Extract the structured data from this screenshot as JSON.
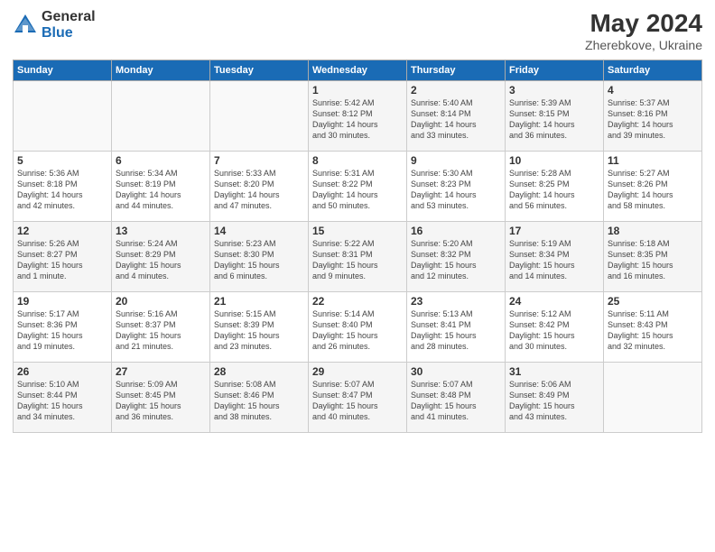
{
  "header": {
    "logo_general": "General",
    "logo_blue": "Blue",
    "month_year": "May 2024",
    "location": "Zherebkove, Ukraine"
  },
  "weekdays": [
    "Sunday",
    "Monday",
    "Tuesday",
    "Wednesday",
    "Thursday",
    "Friday",
    "Saturday"
  ],
  "weeks": [
    [
      {
        "day": "",
        "info": ""
      },
      {
        "day": "",
        "info": ""
      },
      {
        "day": "",
        "info": ""
      },
      {
        "day": "1",
        "info": "Sunrise: 5:42 AM\nSunset: 8:12 PM\nDaylight: 14 hours\nand 30 minutes."
      },
      {
        "day": "2",
        "info": "Sunrise: 5:40 AM\nSunset: 8:14 PM\nDaylight: 14 hours\nand 33 minutes."
      },
      {
        "day": "3",
        "info": "Sunrise: 5:39 AM\nSunset: 8:15 PM\nDaylight: 14 hours\nand 36 minutes."
      },
      {
        "day": "4",
        "info": "Sunrise: 5:37 AM\nSunset: 8:16 PM\nDaylight: 14 hours\nand 39 minutes."
      }
    ],
    [
      {
        "day": "5",
        "info": "Sunrise: 5:36 AM\nSunset: 8:18 PM\nDaylight: 14 hours\nand 42 minutes."
      },
      {
        "day": "6",
        "info": "Sunrise: 5:34 AM\nSunset: 8:19 PM\nDaylight: 14 hours\nand 44 minutes."
      },
      {
        "day": "7",
        "info": "Sunrise: 5:33 AM\nSunset: 8:20 PM\nDaylight: 14 hours\nand 47 minutes."
      },
      {
        "day": "8",
        "info": "Sunrise: 5:31 AM\nSunset: 8:22 PM\nDaylight: 14 hours\nand 50 minutes."
      },
      {
        "day": "9",
        "info": "Sunrise: 5:30 AM\nSunset: 8:23 PM\nDaylight: 14 hours\nand 53 minutes."
      },
      {
        "day": "10",
        "info": "Sunrise: 5:28 AM\nSunset: 8:25 PM\nDaylight: 14 hours\nand 56 minutes."
      },
      {
        "day": "11",
        "info": "Sunrise: 5:27 AM\nSunset: 8:26 PM\nDaylight: 14 hours\nand 58 minutes."
      }
    ],
    [
      {
        "day": "12",
        "info": "Sunrise: 5:26 AM\nSunset: 8:27 PM\nDaylight: 15 hours\nand 1 minute."
      },
      {
        "day": "13",
        "info": "Sunrise: 5:24 AM\nSunset: 8:29 PM\nDaylight: 15 hours\nand 4 minutes."
      },
      {
        "day": "14",
        "info": "Sunrise: 5:23 AM\nSunset: 8:30 PM\nDaylight: 15 hours\nand 6 minutes."
      },
      {
        "day": "15",
        "info": "Sunrise: 5:22 AM\nSunset: 8:31 PM\nDaylight: 15 hours\nand 9 minutes."
      },
      {
        "day": "16",
        "info": "Sunrise: 5:20 AM\nSunset: 8:32 PM\nDaylight: 15 hours\nand 12 minutes."
      },
      {
        "day": "17",
        "info": "Sunrise: 5:19 AM\nSunset: 8:34 PM\nDaylight: 15 hours\nand 14 minutes."
      },
      {
        "day": "18",
        "info": "Sunrise: 5:18 AM\nSunset: 8:35 PM\nDaylight: 15 hours\nand 16 minutes."
      }
    ],
    [
      {
        "day": "19",
        "info": "Sunrise: 5:17 AM\nSunset: 8:36 PM\nDaylight: 15 hours\nand 19 minutes."
      },
      {
        "day": "20",
        "info": "Sunrise: 5:16 AM\nSunset: 8:37 PM\nDaylight: 15 hours\nand 21 minutes."
      },
      {
        "day": "21",
        "info": "Sunrise: 5:15 AM\nSunset: 8:39 PM\nDaylight: 15 hours\nand 23 minutes."
      },
      {
        "day": "22",
        "info": "Sunrise: 5:14 AM\nSunset: 8:40 PM\nDaylight: 15 hours\nand 26 minutes."
      },
      {
        "day": "23",
        "info": "Sunrise: 5:13 AM\nSunset: 8:41 PM\nDaylight: 15 hours\nand 28 minutes."
      },
      {
        "day": "24",
        "info": "Sunrise: 5:12 AM\nSunset: 8:42 PM\nDaylight: 15 hours\nand 30 minutes."
      },
      {
        "day": "25",
        "info": "Sunrise: 5:11 AM\nSunset: 8:43 PM\nDaylight: 15 hours\nand 32 minutes."
      }
    ],
    [
      {
        "day": "26",
        "info": "Sunrise: 5:10 AM\nSunset: 8:44 PM\nDaylight: 15 hours\nand 34 minutes."
      },
      {
        "day": "27",
        "info": "Sunrise: 5:09 AM\nSunset: 8:45 PM\nDaylight: 15 hours\nand 36 minutes."
      },
      {
        "day": "28",
        "info": "Sunrise: 5:08 AM\nSunset: 8:46 PM\nDaylight: 15 hours\nand 38 minutes."
      },
      {
        "day": "29",
        "info": "Sunrise: 5:07 AM\nSunset: 8:47 PM\nDaylight: 15 hours\nand 40 minutes."
      },
      {
        "day": "30",
        "info": "Sunrise: 5:07 AM\nSunset: 8:48 PM\nDaylight: 15 hours\nand 41 minutes."
      },
      {
        "day": "31",
        "info": "Sunrise: 5:06 AM\nSunset: 8:49 PM\nDaylight: 15 hours\nand 43 minutes."
      },
      {
        "day": "",
        "info": ""
      }
    ]
  ]
}
